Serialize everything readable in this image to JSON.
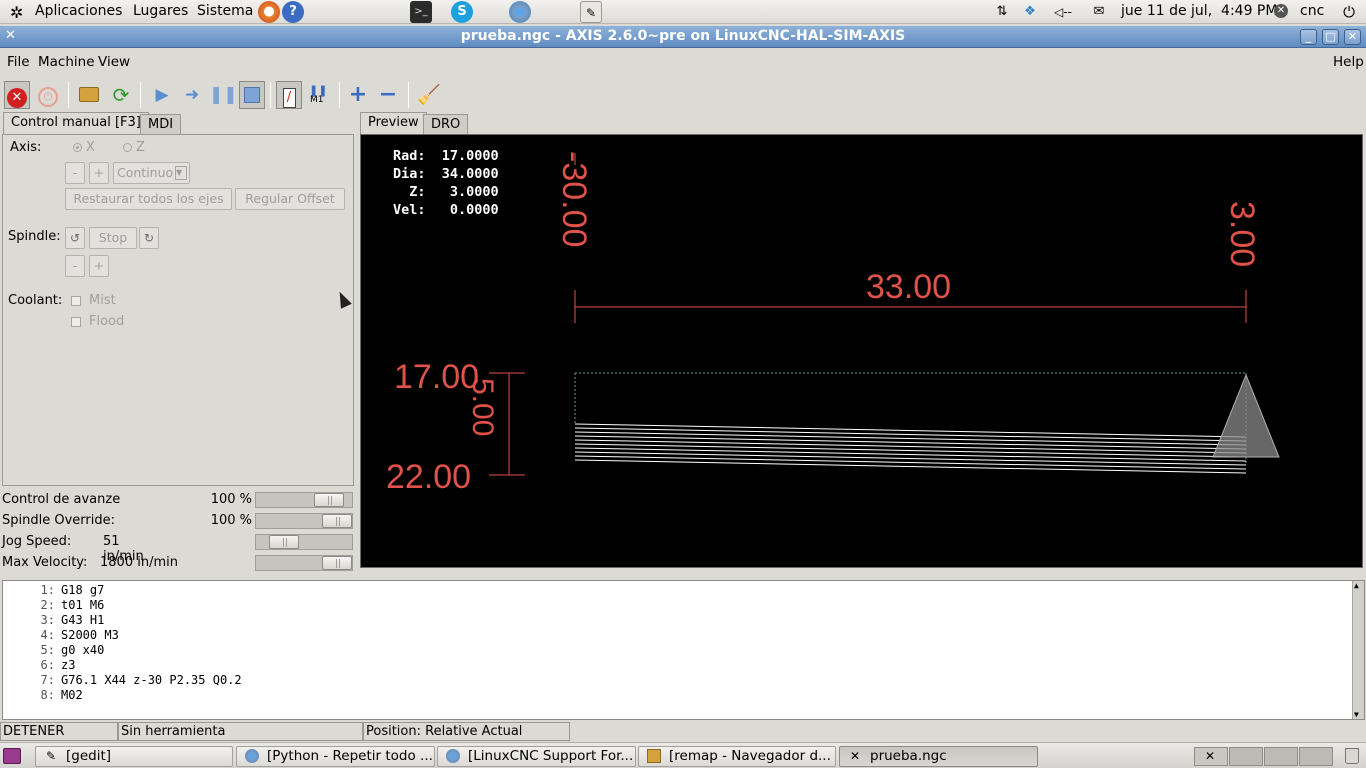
{
  "top_panel": {
    "menus": [
      "Aplicaciones",
      "Lugares",
      "Sistema"
    ],
    "clock": "jue 11 de jul,  4:49 PM",
    "user": "cnc"
  },
  "window": {
    "title": "prueba.ngc - AXIS 2.6.0~pre on LinuxCNC-HAL-SIM-AXIS"
  },
  "menubar": {
    "file": "File",
    "machine": "Machine",
    "view": "View",
    "help": "Help"
  },
  "toolbar": {
    "m1_label": "M1"
  },
  "left_tabs": {
    "manual": "Control manual [F3]",
    "mdi": "MDI"
  },
  "manual": {
    "axis_label": "Axis:",
    "axis_x": "X",
    "axis_z": "Z",
    "minus": "-",
    "plus": "+",
    "jog_mode": "Continuo",
    "home_all": "Restaurar todos los ejes",
    "touch_off": "Regular Offset",
    "spindle_label": "Spindle:",
    "spindle_stop": "Stop",
    "coolant_label": "Coolant:",
    "mist": "Mist",
    "flood": "Flood"
  },
  "sliders": [
    {
      "name": "Control de avanze",
      "value": "100 %",
      "level": 0.88
    },
    {
      "name": "Spindle Override:",
      "value": "100 %",
      "level": 1.0
    },
    {
      "name": "Jog Speed:",
      "value": "51 in/min",
      "level": 0.2
    },
    {
      "name": "Max Velocity:",
      "value": "1800 in/min",
      "level": 1.0
    }
  ],
  "right_tabs": {
    "preview": "Preview",
    "dro": "DRO"
  },
  "dro": {
    "rad_label": "Rad:",
    "rad": "17.0000",
    "dia_label": "Dia:",
    "dia": "34.0000",
    "z_label": "Z:",
    "z": "3.0000",
    "vel_label": "Vel:",
    "vel": "0.0000"
  },
  "preview": {
    "dim_left": "-30.00",
    "dim_right": "3.00",
    "dim_length": "33.00",
    "dim_top": "17.00",
    "dim_bottom": "22.00",
    "dim_depth": "5.00",
    "dim_color": "#e0524a"
  },
  "gcode": [
    {
      "n": "1:",
      "code": "G18 g7"
    },
    {
      "n": "2:",
      "code": "t01 M6"
    },
    {
      "n": "3:",
      "code": "G43 H1"
    },
    {
      "n": "4:",
      "code": "S2000 M3"
    },
    {
      "n": "5:",
      "code": "g0 x40"
    },
    {
      "n": "6:",
      "code": "z3"
    },
    {
      "n": "7:",
      "code": "G76.1 X44 z-30 P2.35 Q0.2"
    },
    {
      "n": "8:",
      "code": "M02"
    }
  ],
  "status": {
    "state": "DETENER",
    "tool": "Sin herramienta",
    "position": "Position: Relative Actual"
  },
  "taskbar": [
    {
      "label": "[gedit]",
      "icon": "gedit-icon"
    },
    {
      "label": "[Python - Repetir todo ...",
      "icon": "chromium-icon"
    },
    {
      "label": "[LinuxCNC Support For...",
      "icon": "chromium-icon"
    },
    {
      "label": "[remap - Navegador d...",
      "icon": "folder-icon"
    },
    {
      "label": "prueba.ngc",
      "icon": "axis-icon"
    }
  ]
}
